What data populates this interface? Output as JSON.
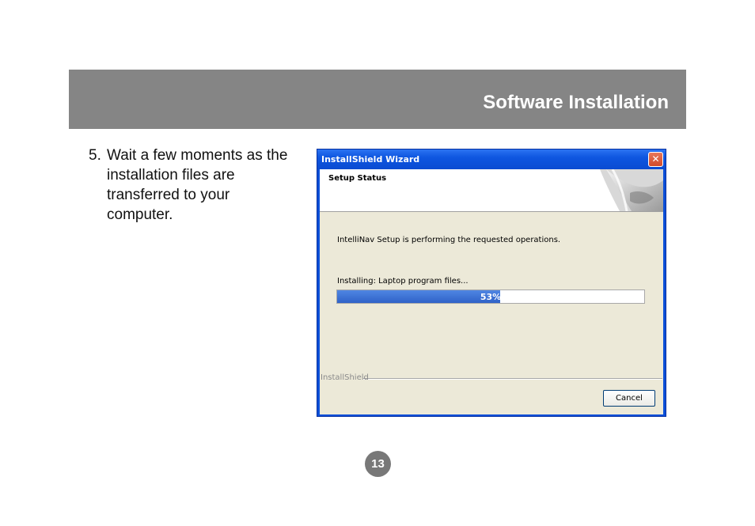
{
  "header": {
    "title": "Software Installation"
  },
  "step": {
    "number": "5.",
    "text": "Wait a few moments as the installation files are transferred to your computer."
  },
  "dialog": {
    "title": "InstallShield Wizard",
    "close_glyph": "✕",
    "banner_title": "Setup Status",
    "status_text": "IntelliNav Setup is performing the requested operations.",
    "installing_text": "Installing: Laptop program files...",
    "progress": {
      "percent": 53,
      "label": "53%"
    },
    "brand": "InstallShield",
    "cancel_label": "Cancel",
    "colors": {
      "titlebar": "#0a4bd2",
      "progress": "#2f62c8",
      "face": "#ece9d8"
    }
  },
  "page": {
    "number": "13"
  }
}
